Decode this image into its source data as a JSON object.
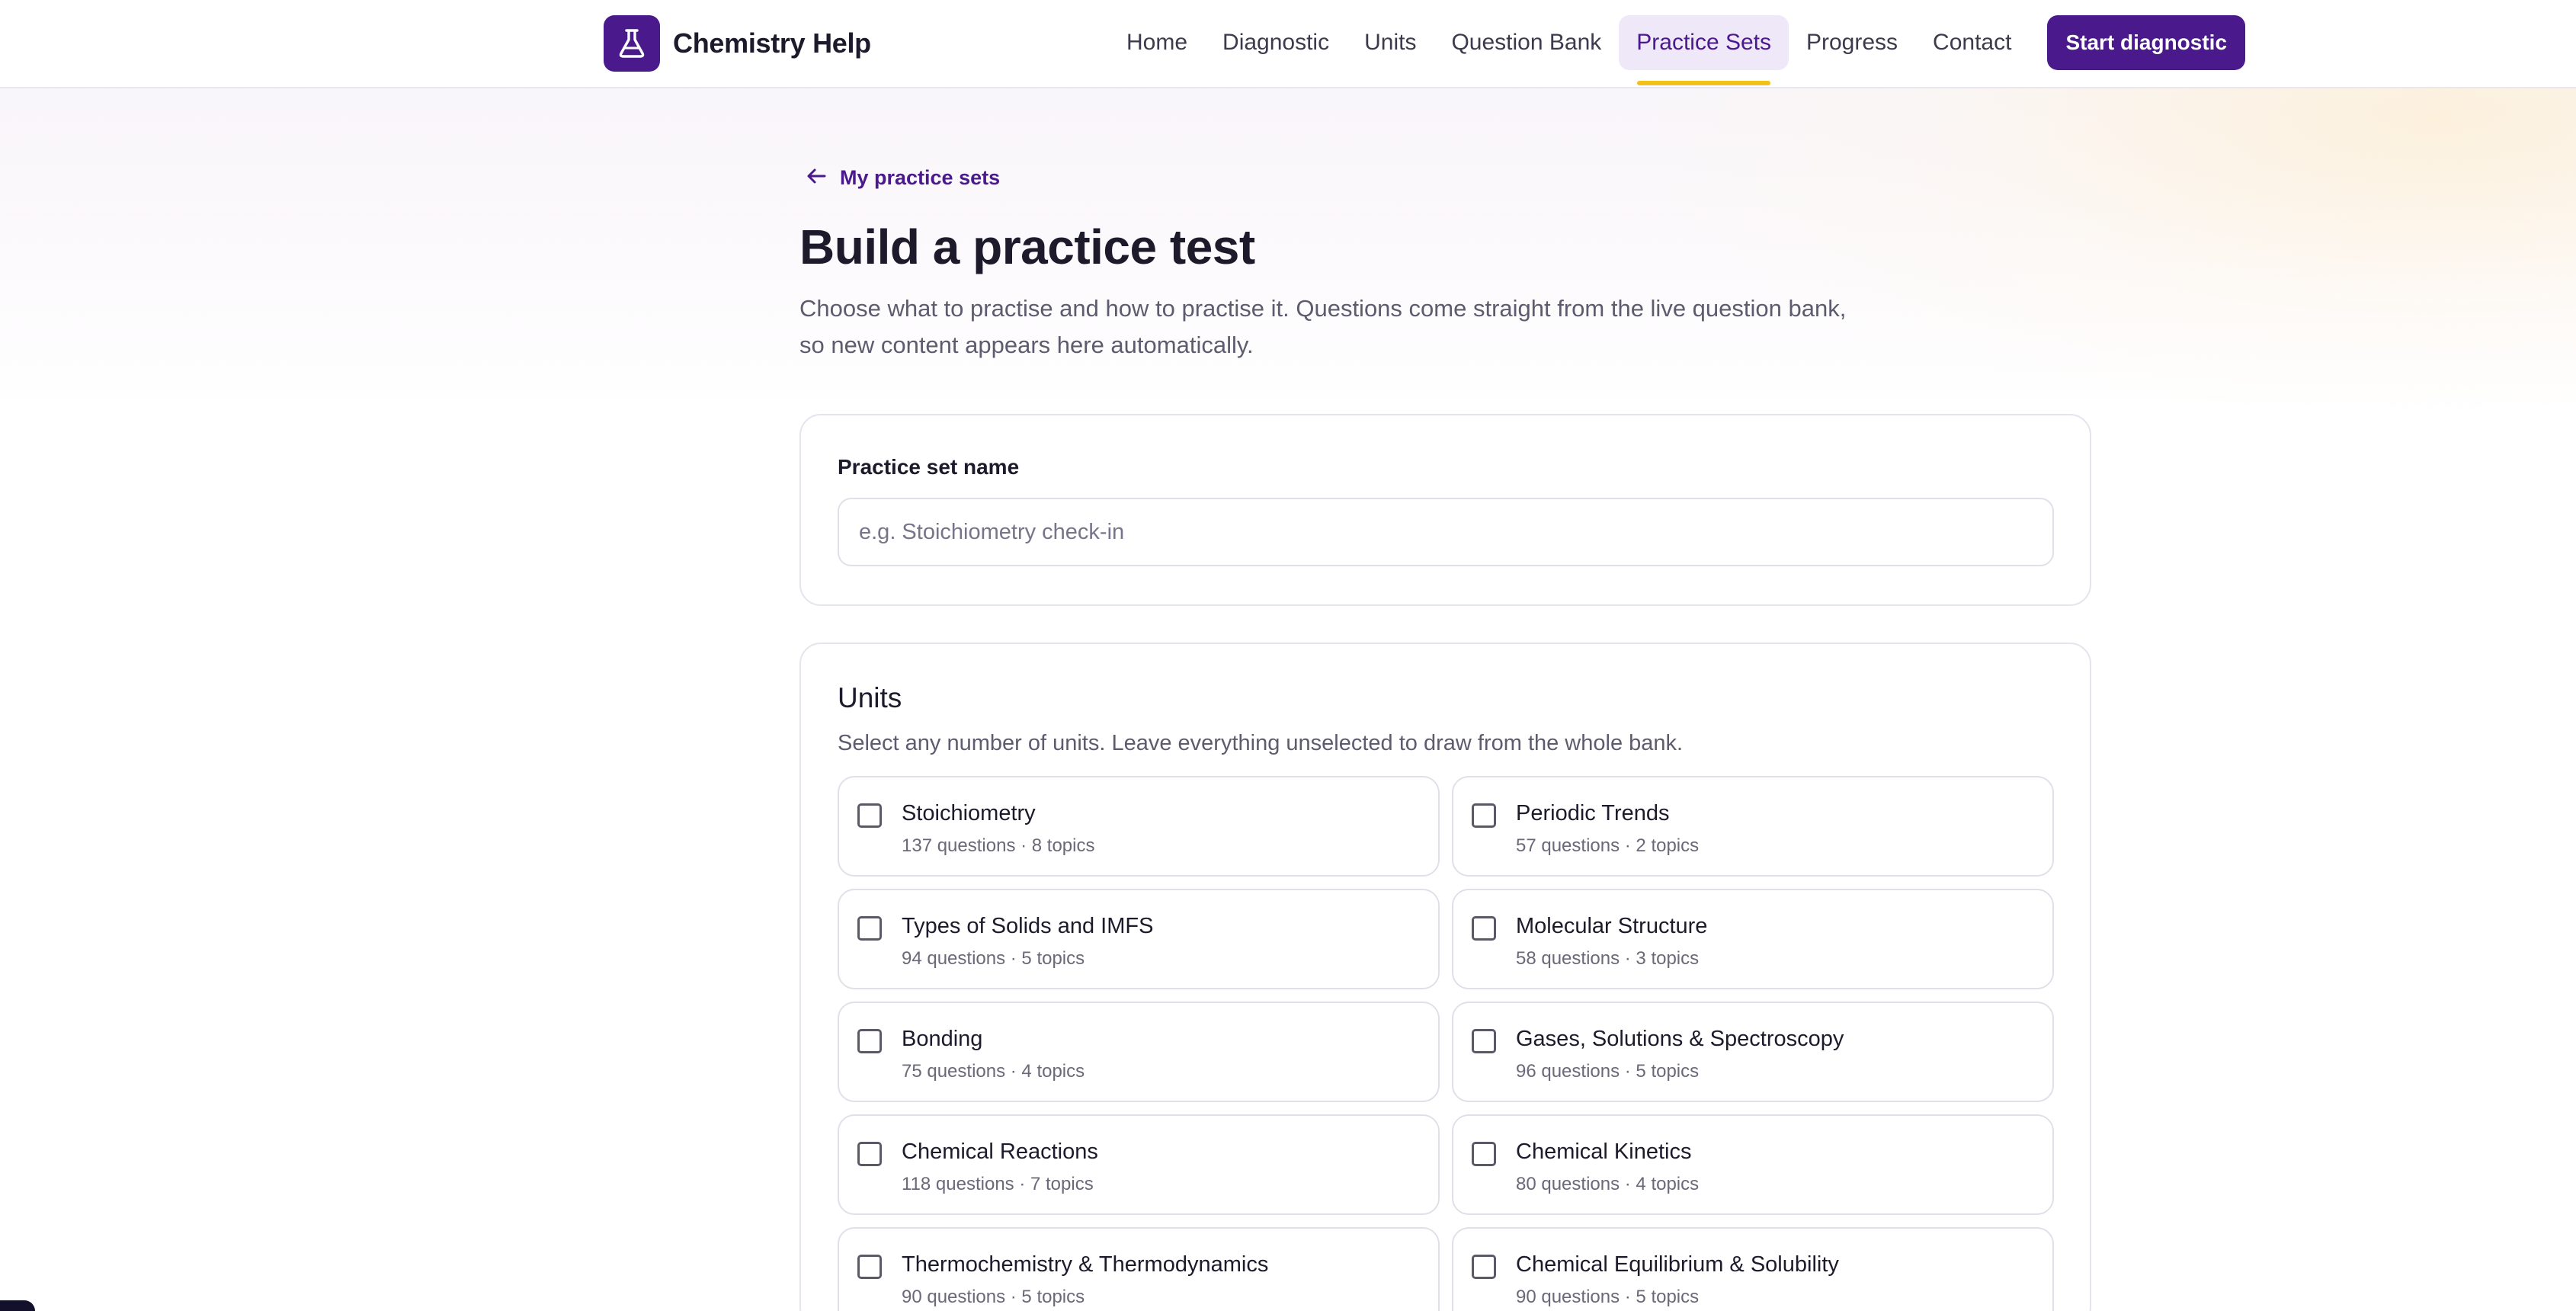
{
  "brand": {
    "name": "Chemistry Help",
    "logo_icon": "flask-icon"
  },
  "nav": {
    "items": [
      {
        "label": "Home",
        "active": false
      },
      {
        "label": "Diagnostic",
        "active": false
      },
      {
        "label": "Units",
        "active": false
      },
      {
        "label": "Question Bank",
        "active": false
      },
      {
        "label": "Practice Sets",
        "active": true
      },
      {
        "label": "Progress",
        "active": false
      },
      {
        "label": "Contact",
        "active": false
      }
    ],
    "cta_label": "Start diagnostic"
  },
  "page": {
    "back_label": "My practice sets",
    "back_icon": "arrow-left-icon",
    "title": "Build a practice test",
    "subtitle": "Choose what to practise and how to practise it. Questions come straight from the live question bank, so new content appears here automatically."
  },
  "name_card": {
    "label": "Practice set name",
    "value": "",
    "placeholder": "e.g. Stoichiometry check-in"
  },
  "units_card": {
    "title": "Units",
    "subtitle": "Select any number of units. Leave everything unselected to draw from the whole bank.",
    "units": [
      {
        "name": "Stoichiometry",
        "meta": "137 questions · 8 topics",
        "checked": false
      },
      {
        "name": "Periodic Trends",
        "meta": "57 questions · 2 topics",
        "checked": false
      },
      {
        "name": "Types of Solids and IMFS",
        "meta": "94 questions · 5 topics",
        "checked": false
      },
      {
        "name": "Molecular Structure",
        "meta": "58 questions · 3 topics",
        "checked": false
      },
      {
        "name": "Bonding",
        "meta": "75 questions · 4 topics",
        "checked": false
      },
      {
        "name": "Gases, Solutions & Spectroscopy",
        "meta": "96 questions · 5 topics",
        "checked": false
      },
      {
        "name": "Chemical Reactions",
        "meta": "118 questions · 7 topics",
        "checked": false
      },
      {
        "name": "Chemical Kinetics",
        "meta": "80 questions · 4 topics",
        "checked": false
      },
      {
        "name": "Thermochemistry & Thermodynamics",
        "meta": "90 questions · 5 topics",
        "checked": false
      },
      {
        "name": "Chemical Equilibrium & Solubility",
        "meta": "90 questions · 5 topics",
        "checked": false
      }
    ]
  },
  "colors": {
    "brand": "#4a1a8c",
    "active_underline": "#f2c21b",
    "active_nav_bg": "#efe8f8"
  }
}
